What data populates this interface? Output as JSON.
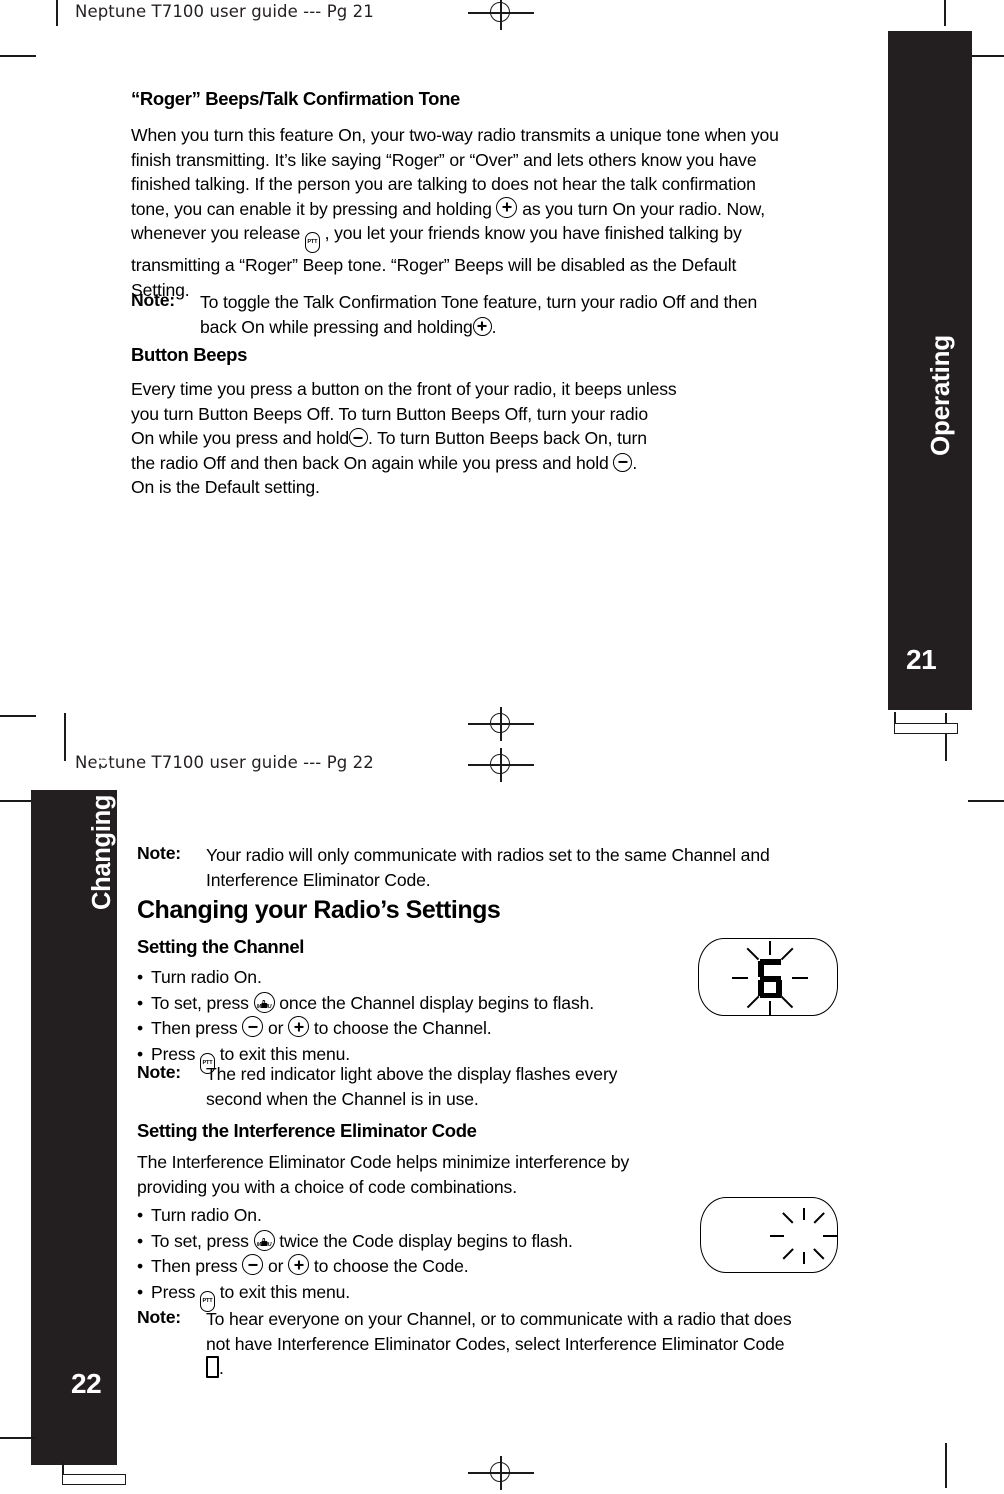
{
  "document": {
    "product": "Neptune T7100",
    "sheets": [
      {
        "label": "Neptune T7100 user guide --- Pg 21"
      },
      {
        "label": "Neptune T7100 user guide --- Pg 22"
      }
    ]
  },
  "page21": {
    "tab": {
      "title": "Operating",
      "page_number": "21",
      "color": "#231f20"
    },
    "heading": "“Roger” Beeps/Talk Confirmation Tone",
    "body_lines_a": [
      "When you turn this feature On, your two-way radio transmits a unique tone when you",
      "finish transmitting. It’s like saying “Roger” or “Over” and lets others know you have",
      "finished talking. If the person you are talking to does not hear the talk confirmation"
    ],
    "body_line_plus_pre": "tone, you can enable it by pressing and holding",
    "body_line_plus_post": "as you turn On your radio. Now,",
    "body_line_ptt_pre": "whenever you release",
    "body_line_ptt_post": ", you let your friends know you have finished talking by",
    "body_lines_b": [
      "transmitting a “Roger” Beep tone. “Roger” Beeps will be disabled as the Default",
      "Setting."
    ],
    "note1": {
      "label": "Note:",
      "line1": "To toggle the Talk Confirmation Tone feature, turn your radio Off and then",
      "line2_pre": "back On while pressing and holding",
      "line2_post": "."
    },
    "subheading": "Button Beeps",
    "beeps_lines_a": [
      "Every time you press a button on the front of your radio, it beeps unless",
      "you turn Button Beeps Off. To turn Button Beeps Off, turn your radio"
    ],
    "beeps_line_minus1_pre": "On while you press and hold",
    "beeps_line_minus1_post": ". To turn Button Beeps back On, turn",
    "beeps_line_minus2_pre": "the radio Off and then back On again while you press and hold",
    "beeps_line_minus2_post": ".",
    "beeps_line_last": "On is the Default setting."
  },
  "page22": {
    "tab": {
      "title": "Changing your Radio’s Settings",
      "page_number": "22",
      "color": "#231f20"
    },
    "note_top": {
      "label": "Note:",
      "line1": "Your radio will only communicate with radios set to the same Channel and",
      "line2": "Interference Eliminator Code."
    },
    "heading": "Changing your Radio’s Settings",
    "section1": {
      "subheading": "Setting the Channel",
      "bullets": [
        {
          "pre": "Turn radio On.",
          "icon": null,
          "post": ""
        },
        {
          "pre": "To set, press",
          "icon": "menu-key-icon",
          "post": "once the Channel display begins to flash."
        },
        {
          "pre": "Then press",
          "icon": "minus-or-plus-key-icon",
          "post": "to choose the Channel."
        },
        {
          "pre": "Press",
          "icon": "ptt-key-icon",
          "post": "to exit this menu."
        }
      ],
      "bullet3_mid": "or",
      "note": {
        "label": "Note:",
        "line1": "The red indicator light above the display flashes every",
        "line2": "second when the Channel is in use."
      },
      "display": {
        "value": "6",
        "flashing": true,
        "caption": "channel-display"
      }
    },
    "section2": {
      "subheading": "Setting the Interference Eliminator Code",
      "intro_lines": [
        "The Interference Eliminator Code helps minimize interference by",
        "providing you with a choice of code combinations."
      ],
      "bullets": [
        {
          "pre": "Turn radio On.",
          "icon": null,
          "post": ""
        },
        {
          "pre": "To set, press",
          "icon": "menu-key-icon",
          "post": "twice the Code display begins to flash."
        },
        {
          "pre": "Then press",
          "icon": "minus-or-plus-key-icon",
          "post": "to choose the Code."
        },
        {
          "pre": "Press",
          "icon": "ptt-key-icon",
          "post": "to exit this menu."
        }
      ],
      "bullet3_mid": "or",
      "note": {
        "label": "Note:",
        "line1": "To hear everyone on your Channel, or to communicate with a radio that does",
        "line2": "not have Interference Eliminator Codes, select Interference Eliminator Code",
        "line3_post": "."
      },
      "display": {
        "value": "",
        "flashing": true,
        "caption": "code-display"
      }
    }
  }
}
